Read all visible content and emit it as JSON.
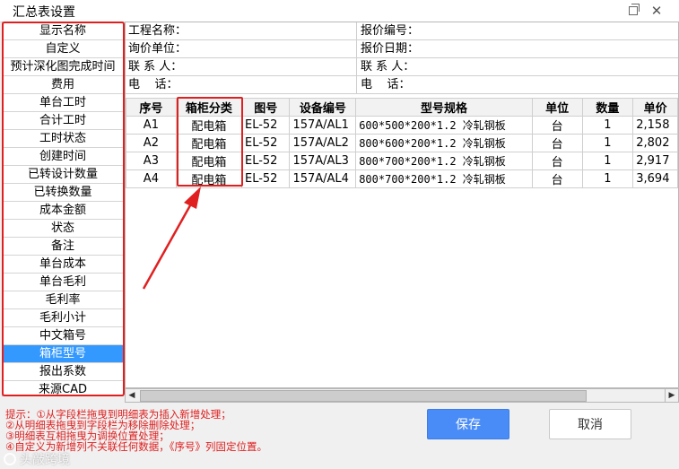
{
  "window": {
    "title": "汇总表设置"
  },
  "field_list": {
    "items": [
      "显示名称",
      "自定义",
      "预计深化图完成时间",
      "费用",
      "单台工时",
      "合计工时",
      "工时状态",
      "创建时间",
      "已转设计数量",
      "已转换数量",
      "成本金额",
      "状态",
      "备注",
      "单台成本",
      "单台毛利",
      "毛利率",
      "毛利小计",
      "中文箱号",
      "箱柜型号",
      "报出系数",
      "来源CAD"
    ],
    "selected": "箱柜型号"
  },
  "preview": {
    "header": {
      "project_name": "工程名称：",
      "quote_no": "报价编号：",
      "inquiry_unit": "询价单位：",
      "quote_date": "报价日期：",
      "contact_left": "联 系 人：",
      "contact_right": "联 系 人：",
      "phone_left": "电    话：",
      "phone_right": "电    话："
    },
    "columns": [
      "序号",
      "箱柜分类",
      "图号",
      "设备编号",
      "型号规格",
      "单位",
      "数量",
      "单价"
    ],
    "rows": [
      [
        "A1",
        "配电箱",
        "EL-52",
        "157A/AL1",
        "600*500*200*1.2 冷轧钢板",
        "台",
        "1",
        "2,158"
      ],
      [
        "A2",
        "配电箱",
        "EL-52",
        "157A/AL2",
        "800*600*200*1.2 冷轧钢板",
        "台",
        "1",
        "2,802"
      ],
      [
        "A3",
        "配电箱",
        "EL-52",
        "157A/AL3",
        "800*700*200*1.2 冷轧钢板",
        "台",
        "1",
        "2,917"
      ],
      [
        "A4",
        "配电箱",
        "EL-52",
        "157A/AL4",
        "800*700*200*1.2 冷轧钢板",
        "台",
        "1",
        "3,694"
      ]
    ]
  },
  "tips": [
    "提示：①从字段栏拖曳到明细表为插入新增处理；",
    "②从明细表拖曳到字段栏为移除删除处理；",
    "③明细表互相拖曳为调换位置处理；",
    "④自定义为新增列不关联任何数据，《序号》列固定位置。"
  ],
  "buttons": {
    "save": "保存",
    "cancel": "取消"
  },
  "watermark": "头敲跨境",
  "colors": {
    "highlight_red": "#e02020",
    "selected_blue": "#3399ff",
    "save_blue": "#4a8cf7"
  }
}
